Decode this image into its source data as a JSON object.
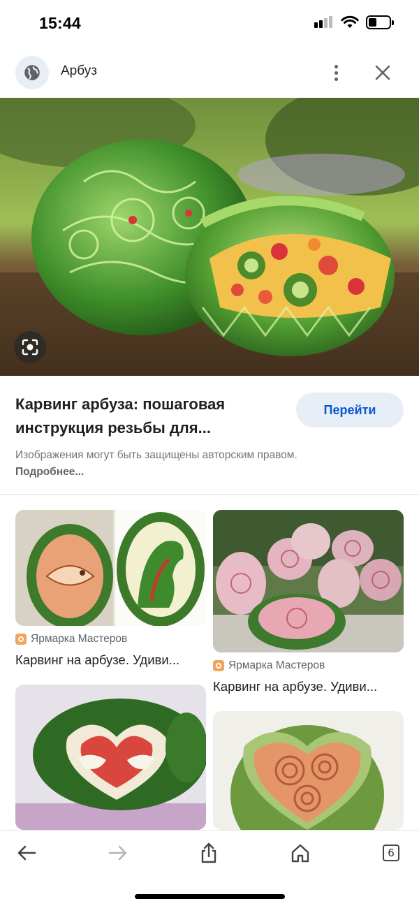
{
  "status_bar": {
    "time": "15:44"
  },
  "header": {
    "title": "Арбуз",
    "icons": [
      "globe-icon",
      "more-vert-icon",
      "close-icon"
    ]
  },
  "hero": {
    "description_icon": "lens-camera-icon"
  },
  "result": {
    "title": "Карвинг арбуза: пошаговая инструкция резьбы для...",
    "visit_label": "Перейти",
    "copyright_text": "Изображения могут быть защищены авторским правом.",
    "more_link": "Подробнее..."
  },
  "related": [
    {
      "source": "Ярмарка Мастеров",
      "caption": "Карвинг на арбузе. Удиви..."
    },
    {
      "source": "Ярмарка Мастеров",
      "caption": "Карвинг на арбузе. Удиви..."
    }
  ],
  "toolbar": {
    "tabs_count": "6"
  },
  "colors": {
    "accent": "#0b57d0",
    "button_bg": "#e8eef8",
    "source_icon": "#f2a45c"
  }
}
